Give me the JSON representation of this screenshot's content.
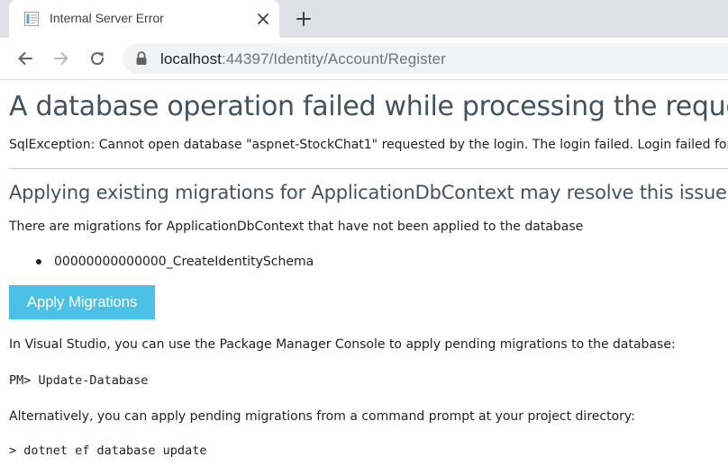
{
  "browser": {
    "tab": {
      "title": "Internal Server Error",
      "favicon": "document-icon",
      "close_icon": "close-icon"
    },
    "new_tab_icon": "plus-icon",
    "nav": {
      "back_icon": "arrow-left-icon",
      "forward_icon": "arrow-right-icon",
      "reload_icon": "reload-icon"
    },
    "address_bar": {
      "lock_icon": "lock-icon",
      "host": "localhost",
      "rest": ":44397/Identity/Account/Register"
    }
  },
  "page": {
    "title": "A database operation failed while processing the request.",
    "exception": "SqlException: Cannot open database \"aspnet-StockChat1\" requested by the login. The login failed. Login failed for user",
    "subtitle": "Applying existing migrations for ApplicationDbContext may resolve this issue",
    "intro": "There are migrations for ApplicationDbContext that have not been applied to the database",
    "migrations": [
      "00000000000000_CreateIdentitySchema"
    ],
    "apply_button_label": "Apply Migrations",
    "vs_instructions": "In Visual Studio, you can use the Package Manager Console to apply pending migrations to the database:",
    "pm_command": "PM> Update-Database",
    "alt_instructions": "Alternatively, you can apply pending migrations from a command prompt at your project directory:",
    "cli_command": "> dotnet ef database update"
  },
  "colors": {
    "tabstrip_bg": "#dee1e6",
    "omnibox_bg": "#f1f3f4",
    "heading": "#44525e",
    "button_bg": "#4cc1e8",
    "divider": "#cccccc"
  }
}
